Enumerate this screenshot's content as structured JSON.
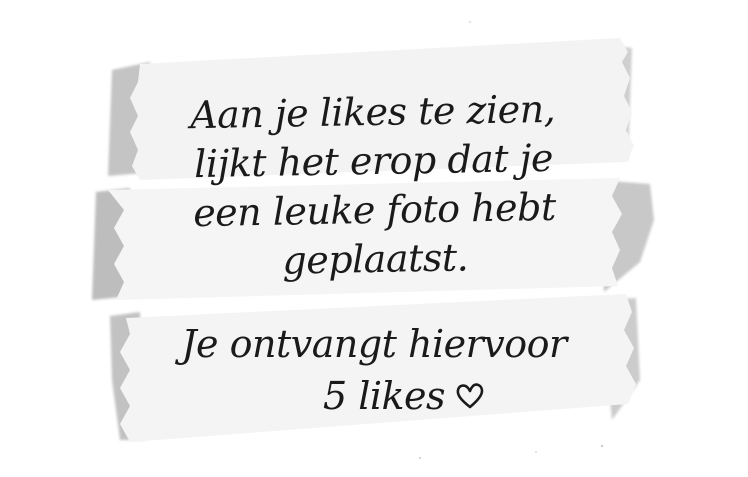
{
  "message": {
    "lines": [
      "Aan je likes te zien,",
      "lijkt het erop dat je",
      "een leuke foto hebt",
      "geplaatst."
    ]
  },
  "reward": {
    "line1": "Je ontvangt hiervoor",
    "line2": "5 likes"
  },
  "icons": {
    "heart": "heart-outline-icon"
  },
  "colors": {
    "text": "#1a1a1a",
    "tape": "#f4f4f4",
    "tape_shadow": "#bdbdbd",
    "background": "#ffffff"
  }
}
